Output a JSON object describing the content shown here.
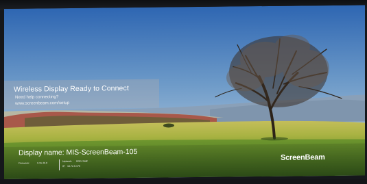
{
  "overlay": {
    "title": "Wireless Display Ready to Connect",
    "help_text": "Need help connecting?",
    "help_url": "www.screenbeam.com/setup"
  },
  "footer": {
    "display_name": "Display name: MIS-ScreenBeam-105",
    "firmware_label": "Firmware:",
    "firmware_value": "9.15.46.0",
    "network_label": "Network:",
    "network_value": "0201-Staff",
    "ip_label": "IP:",
    "ip_value": "10.72.0.176",
    "brand": "ScreenBeam"
  },
  "colors": {
    "sky_top": "#2e66b2",
    "sky_horizon": "#c8d7e2",
    "meadow": "#a9b343",
    "grass_foreground": "#4b7b26"
  },
  "icons": {
    "logo": "screenbeam-logo"
  }
}
